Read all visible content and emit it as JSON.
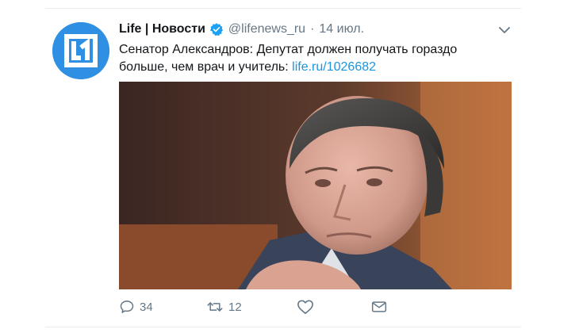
{
  "tweet": {
    "author_name": "Life | Новости",
    "handle": "@lifenews_ru",
    "separator": "·",
    "date": "14 июл.",
    "text_before_link": "Сенатор Александров: Депутат должен получать гораздо больше, чем врач и учитель: ",
    "link_text": "life.ru/1026682",
    "icons": {
      "avatar": "life-logo-icon",
      "verified": "verified-badge-icon",
      "menu": "chevron-down-icon"
    },
    "colors": {
      "link": "#1b95e0",
      "verified": "#1da1f2",
      "avatar_bg": "#2e8fe3",
      "muted": "#657786"
    }
  },
  "actions": {
    "reply_count": "34",
    "retweet_count": "12",
    "icons": [
      "reply-icon",
      "retweet-icon",
      "like-icon",
      "direct-message-icon"
    ]
  }
}
